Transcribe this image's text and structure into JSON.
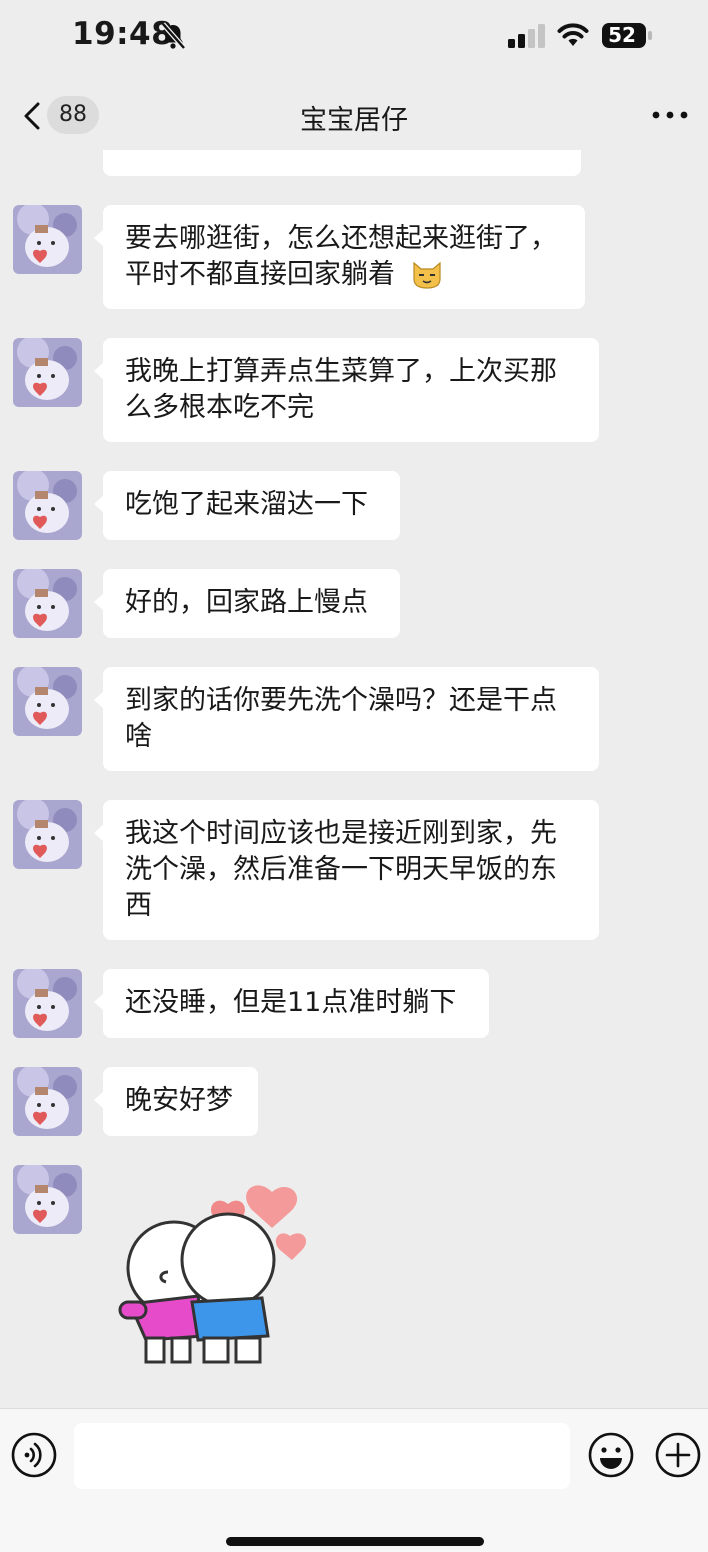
{
  "status_bar": {
    "time": "19:48",
    "battery": "52",
    "icons": [
      "bell-slash-icon",
      "cellular-signal-icon",
      "wifi-icon",
      "battery-icon"
    ]
  },
  "nav": {
    "back_icon": "chevron-left-icon",
    "unread_count": "88",
    "title": "宝宝居仔",
    "more_icon": "more-icon"
  },
  "messages": [
    {
      "text": "要去哪逛街，怎么还想起来逛街了，\n平时不都直接回家躺着",
      "emoji": "cat-face-emoji"
    },
    {
      "text": "我晚上打算弄点生菜算了，上次买那\n么多根本吃不完"
    },
    {
      "text": "吃饱了起来溜达一下"
    },
    {
      "text": "好的，回家路上慢点"
    },
    {
      "text": "到家的话你要先洗个澡吗？还是干点\n啥"
    },
    {
      "text": "我这个时间应该也是接近刚到家，先\n洗个澡，然后准备一下明天早饭的东\n西"
    },
    {
      "text": "还没睡，但是11点准时躺下"
    },
    {
      "text": "晚安好梦"
    }
  ],
  "sticker": {
    "icon": "hug-sticker-icon"
  },
  "input_bar": {
    "voice_icon": "voice-icon",
    "input_value": "",
    "emoji_icon": "emoji-icon",
    "plus_icon": "plus-icon"
  },
  "colors": {
    "background": "#ededed",
    "bubble": "#ffffff",
    "text": "#191919",
    "input_bar": "#f7f7f7"
  }
}
